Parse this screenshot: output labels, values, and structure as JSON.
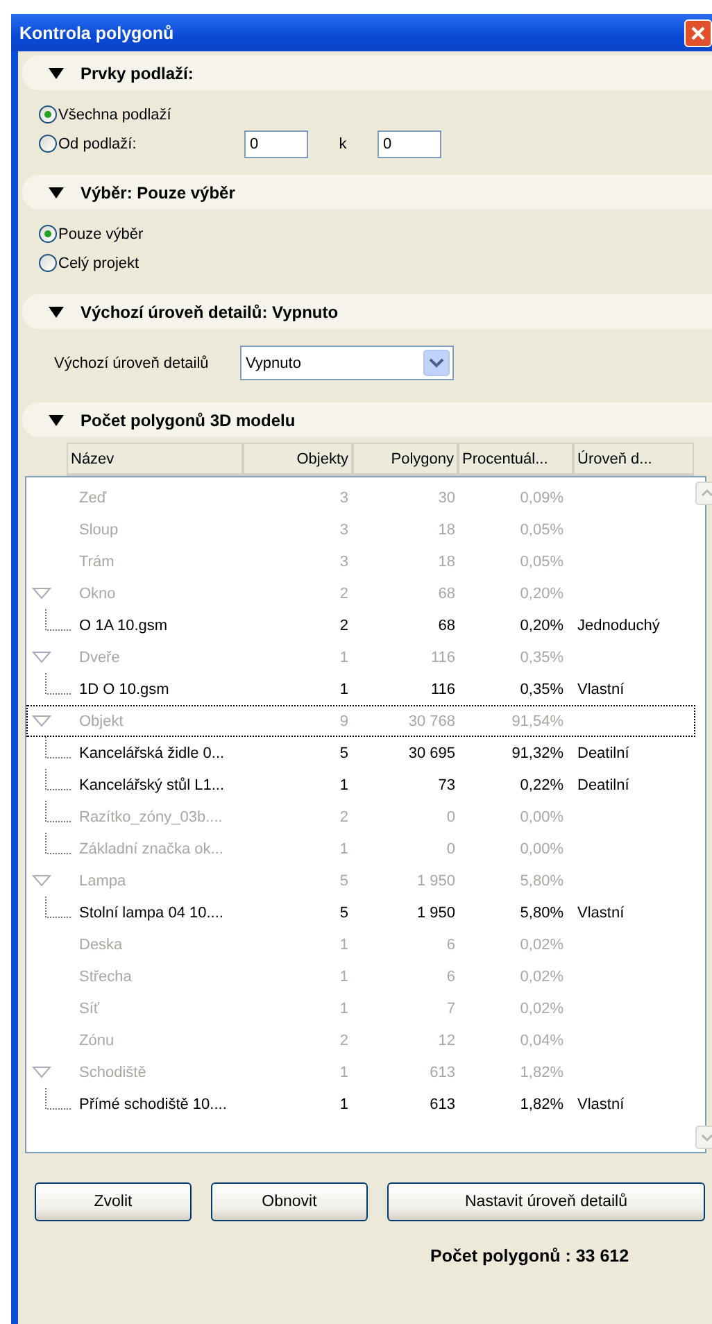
{
  "window": {
    "title": "Kontrola polygonů"
  },
  "sections": [
    {
      "kind": "radios",
      "title": "Prvky podlaží:",
      "expanded": true,
      "options": [
        {
          "label": "Všechna podlaží",
          "selected": true
        },
        {
          "label": "Od podlaží:",
          "selected": false,
          "range": {
            "from": "0",
            "separator": "k",
            "to": "0"
          }
        }
      ]
    },
    {
      "kind": "radios",
      "title": "Výběr: Pouze výběr",
      "expanded": true,
      "options": [
        {
          "label": "Pouze výběr",
          "selected": true
        },
        {
          "label": "Celý projekt",
          "selected": false
        }
      ]
    },
    {
      "kind": "select",
      "title": "Výchozí úroveň detailů: Vypnuto",
      "expanded": true,
      "label": "Výchozí úroveň detailů",
      "value": "Vypnuto"
    },
    {
      "kind": "table",
      "title": "Počet polygonů 3D modelu",
      "expanded": true,
      "columns": [
        "Název",
        "Objekty",
        "Polygony",
        "Procentuál...",
        "Úroveň d..."
      ],
      "rows": [
        {
          "name": "Zeď",
          "objects": "3",
          "polygons": "30",
          "percent": "0,09%",
          "dimmed": true,
          "selected": false
        },
        {
          "name": "Sloup",
          "objects": "3",
          "polygons": "18",
          "percent": "0,05%",
          "dimmed": true,
          "selected": false
        },
        {
          "name": "Trám",
          "objects": "3",
          "polygons": "18",
          "percent": "0,05%",
          "dimmed": true,
          "selected": false
        },
        {
          "name": "Okno",
          "objects": "2",
          "polygons": "68",
          "percent": "0,20%",
          "dimmed": true,
          "selected": false,
          "expanded": true,
          "children": [
            {
              "name": "O 1A 10.gsm",
              "objects": "2",
              "polygons": "68",
              "percent": "0,20%",
              "detail": "Jednoduchý",
              "dimmed": false,
              "selected": false
            }
          ]
        },
        {
          "name": "Dveře",
          "objects": "1",
          "polygons": "116",
          "percent": "0,35%",
          "dimmed": true,
          "selected": false,
          "expanded": true,
          "children": [
            {
              "name": "1D O 10.gsm",
              "objects": "1",
              "polygons": "116",
              "percent": "0,35%",
              "detail": "Vlastní",
              "dimmed": false,
              "selected": false
            }
          ]
        },
        {
          "name": "Objekt",
          "objects": "9",
          "polygons": "30 768",
          "percent": "91,54%",
          "dimmed": true,
          "selected": true,
          "expanded": true,
          "children": [
            {
              "name": "Kancelářská židle 0...",
              "objects": "5",
              "polygons": "30 695",
              "percent": "91,32%",
              "detail": "Deatilní",
              "dimmed": false,
              "selected": false
            },
            {
              "name": "Kancelářský stůl L1...",
              "objects": "1",
              "polygons": "73",
              "percent": "0,22%",
              "detail": "Deatilní",
              "dimmed": false,
              "selected": false
            },
            {
              "name": "Razítko_zóny_03b....",
              "objects": "2",
              "polygons": "0",
              "percent": "0,00%",
              "dimmed": true,
              "selected": false
            },
            {
              "name": "Základní značka ok...",
              "objects": "1",
              "polygons": "0",
              "percent": "0,00%",
              "dimmed": true,
              "selected": false
            }
          ]
        },
        {
          "name": "Lampa",
          "objects": "5",
          "polygons": "1 950",
          "percent": "5,80%",
          "dimmed": true,
          "selected": false,
          "expanded": true,
          "children": [
            {
              "name": "Stolní lampa 04 10....",
              "objects": "5",
              "polygons": "1 950",
              "percent": "5,80%",
              "detail": "Vlastní",
              "dimmed": false,
              "selected": false
            }
          ]
        },
        {
          "name": "Deska",
          "objects": "1",
          "polygons": "6",
          "percent": "0,02%",
          "dimmed": true,
          "selected": false
        },
        {
          "name": "Střecha",
          "objects": "1",
          "polygons": "6",
          "percent": "0,02%",
          "dimmed": true,
          "selected": false
        },
        {
          "name": "Síť",
          "objects": "1",
          "polygons": "7",
          "percent": "0,02%",
          "dimmed": true,
          "selected": false
        },
        {
          "name": "Zónu",
          "objects": "2",
          "polygons": "12",
          "percent": "0,04%",
          "dimmed": true,
          "selected": false
        },
        {
          "name": "Schodiště",
          "objects": "1",
          "polygons": "613",
          "percent": "1,82%",
          "dimmed": true,
          "selected": false,
          "expanded": true,
          "children": [
            {
              "name": "Přímé schodiště 10....",
              "objects": "1",
              "polygons": "613",
              "percent": "1,82%",
              "detail": "Vlastní",
              "dimmed": false,
              "selected": false
            }
          ]
        }
      ]
    }
  ],
  "buttons": [
    "Zvolit",
    "Obnovit",
    "Nastavit úroveň detailů"
  ],
  "total": "Počet polygonů : 33 612"
}
